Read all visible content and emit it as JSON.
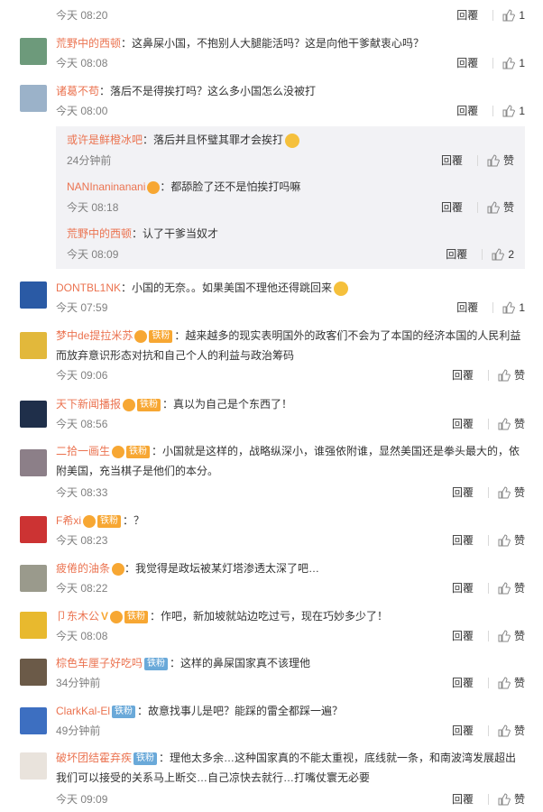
{
  "ui": {
    "reply": "回覆",
    "colon": "："
  },
  "colors": {
    "name": "#eb7350",
    "time": "#808080",
    "subbg": "#f2f2f5"
  },
  "comments": [
    {
      "time": "今天 08:20",
      "likes": "1"
    },
    {
      "user": "荒野中的西顿",
      "text": "这鼻屎小国，不抱别人大腿能活吗？这是向他干爹献衷心吗？",
      "time": "今天 08:08",
      "likes": "1"
    },
    {
      "user": "诸葛不苟",
      "text": "落后不是得挨打吗？这么多小国怎么没被打",
      "time": "今天 08:00",
      "likes": "1",
      "replies": [
        {
          "user": "或许是鲜橙冰吧",
          "text": "落后并且怀璧其罪才会挨打",
          "time": "24分钟前",
          "likes": "赞"
        },
        {
          "user": "NANInaninanani",
          "text": "都舔脸了还不是怕挨打吗嘛",
          "time": "今天 08:18",
          "likes": "赞"
        },
        {
          "user": "荒野中的西顿",
          "text": "认了干爹当奴才",
          "time": "今天 08:09",
          "likes": "2"
        }
      ]
    },
    {
      "user": "DONTBL1NK",
      "text": "小国的无奈。。如果美国不理他还得跳回来",
      "time": "今天 07:59",
      "likes": "1"
    },
    {
      "user": "梦中de提拉米苏",
      "badge": "铁粉",
      "text": "越来越多的现实表明国外的政客们不会为了本国的经济本国的人民利益而放弃意识形态对抗和自己个人的利益与政治筹码",
      "time": "今天 09:06",
      "likes": "赞"
    },
    {
      "user": "天下新闻播报",
      "badge": "铁粉",
      "text": "真以为自己是个东西了！",
      "time": "今天 08:56",
      "likes": "赞"
    },
    {
      "user": "二拾一画生",
      "badge": "铁粉",
      "text": "小国就是这样的，战略纵深小，谁强依附谁，显然美国还是拳头最大的，依附美国，充当棋子是他们的本分。",
      "time": "今天 08:33",
      "likes": "赞"
    },
    {
      "user": "F希xi",
      "badge": "铁粉",
      "text": "？",
      "time": "今天 08:23",
      "likes": "赞"
    },
    {
      "user": "疲倦的油条",
      "text": "我觉得是政坛被某灯塔渗透太深了吧…",
      "time": "今天 08:22",
      "likes": "赞"
    },
    {
      "user": "卩东木公",
      "badge": "铁粉",
      "text": "作吧，新加坡就站边吃过亏，现在巧妙多少了！",
      "time": "今天 08:08",
      "likes": "赞"
    },
    {
      "user": "棕色车厘子好吃吗",
      "badge2": "铁粉",
      "text": "这样的鼻屎国家真不该理他",
      "time": "34分钟前",
      "likes": "赞"
    },
    {
      "user": "ClarkKal-El",
      "badge2": "铁粉",
      "text": "故意找事儿是吧？能踩的雷全都踩一遍？",
      "time": "49分钟前",
      "likes": "赞"
    },
    {
      "user": "破坏团结霍弃疾",
      "badge2": "铁粉",
      "text": "理他太多余…这种国家真的不能太重视，底线就一条，和南波湾发展超出我们可以接受的关系马上断交…自己凉快去就行…打嘴仗寰无必要",
      "time": "今天 09:09",
      "likes": "赞"
    }
  ]
}
